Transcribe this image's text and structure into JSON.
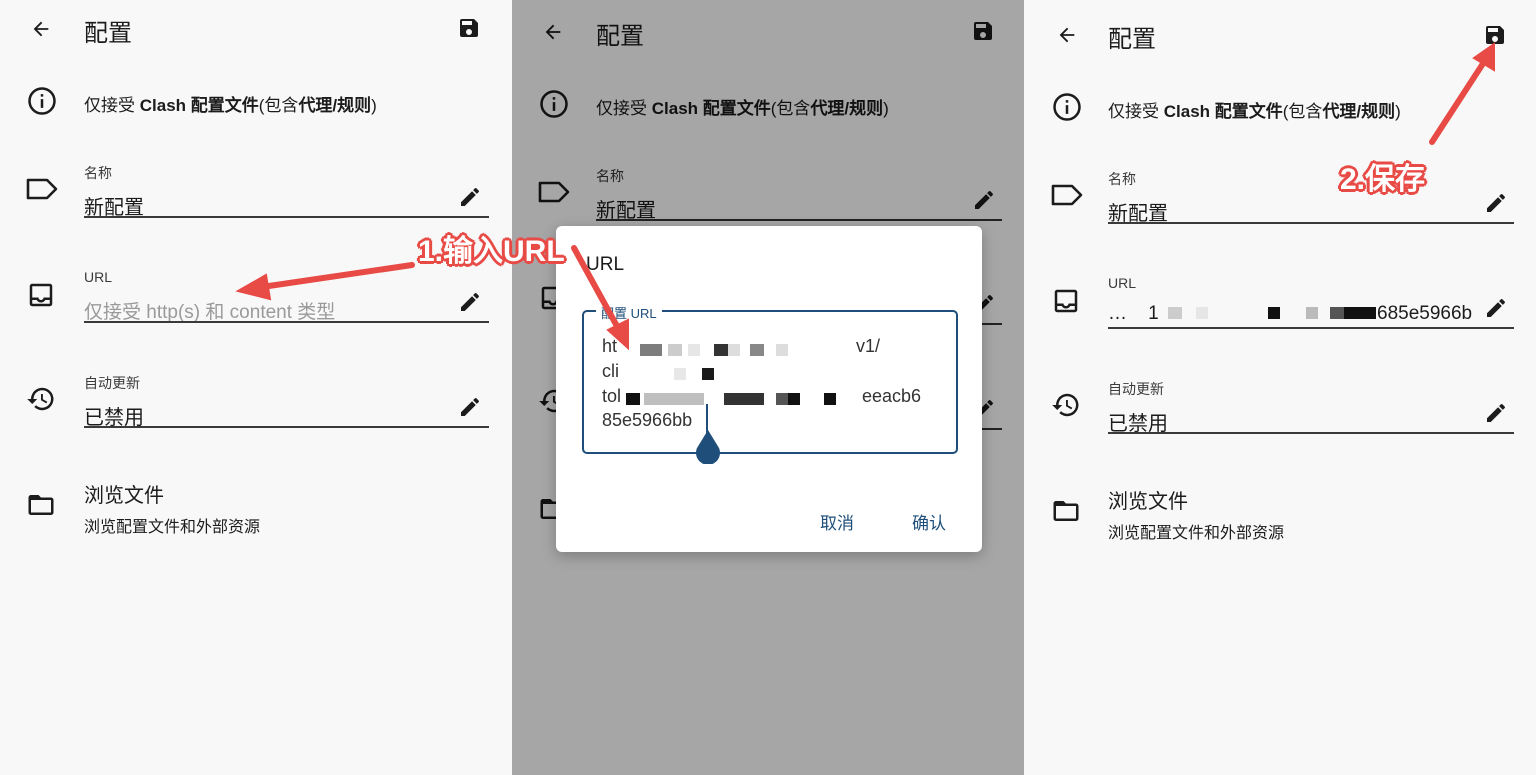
{
  "screen": {
    "title": "配置",
    "info_plain1": "仅接受 ",
    "info_bold1": "Clash 配置文件",
    "info_plain2": "(包含",
    "info_bold2": "代理/规则",
    "info_plain3": ")",
    "name_label": "名称",
    "name_value": "新配置",
    "url_label": "URL",
    "url_placeholder": "仅接受 http(s) 和 content 类型",
    "update_label": "自动更新",
    "update_value": "已禁用",
    "browse_title": "浏览文件",
    "browse_subtitle": "浏览配置文件和外部资源"
  },
  "step3": {
    "url_value_prefix": "…    1",
    "url_value_suffix": "685e5966b"
  },
  "dialog": {
    "title": "URL",
    "field_label": "配置 URL",
    "line1_start": "ht",
    "line1_end": "v1/",
    "line2_start": "cli",
    "line3_start": "tol",
    "line3_end": "eeacb6",
    "line4": "85e5966bb",
    "cancel": "取消",
    "confirm": "确认"
  },
  "annotations": {
    "step1": "1.输入URL",
    "step2": "2.保存"
  },
  "colors": {
    "accent": "#1e4e79",
    "annotation": "#e84a45",
    "scrim": "#a6a6a6"
  }
}
